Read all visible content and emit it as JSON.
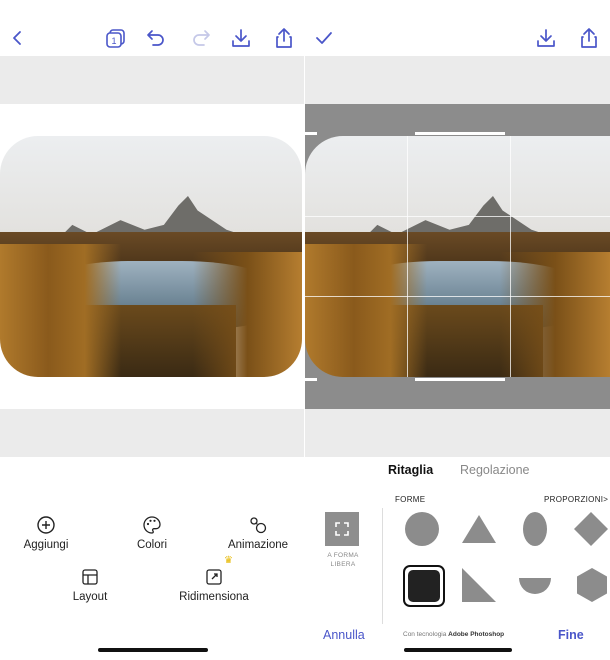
{
  "colors": {
    "accent": "#4a56c9",
    "disabled": "#c5c8e8",
    "grey_band": "#ebebeb",
    "crop_shade": "#8c8c8c",
    "crown": "#e6b800"
  },
  "left_pane": {
    "topbar_icons": [
      "back-chevron-icon",
      "layers-count-icon",
      "undo-icon",
      "redo-icon",
      "download-icon",
      "share-icon"
    ],
    "layers_count": "1",
    "tools": [
      {
        "label": "Aggiungi",
        "icon": "add-circle-icon"
      },
      {
        "label": "Colori",
        "icon": "palette-icon"
      },
      {
        "label": "Animazione",
        "icon": "animation-icon"
      },
      {
        "label": "Layout",
        "icon": "layout-icon"
      },
      {
        "label": "Ridimensiona",
        "icon": "resize-icon",
        "premium": true
      }
    ]
  },
  "right_pane": {
    "topbar_icons": [
      "checkmark-icon",
      "download-icon",
      "share-icon"
    ],
    "tabs": [
      {
        "label": "Ritaglia",
        "active": true
      },
      {
        "label": "Regolazione",
        "active": false
      }
    ],
    "shapes_label": "FORME",
    "proportions_label": "PROPORZIONI>",
    "free_form_label": "A FORMA LIBERA",
    "shapes": [
      "circle",
      "triangle",
      "ellipse",
      "diamond",
      "rounded-square",
      "right-triangle",
      "half-circle",
      "hexagon"
    ],
    "selected_shape": "rounded-square",
    "cancel_label": "Annulla",
    "done_label": "Fine",
    "powered_prefix": "Con tecnologia ",
    "powered_brand": "Adobe Photoshop"
  }
}
